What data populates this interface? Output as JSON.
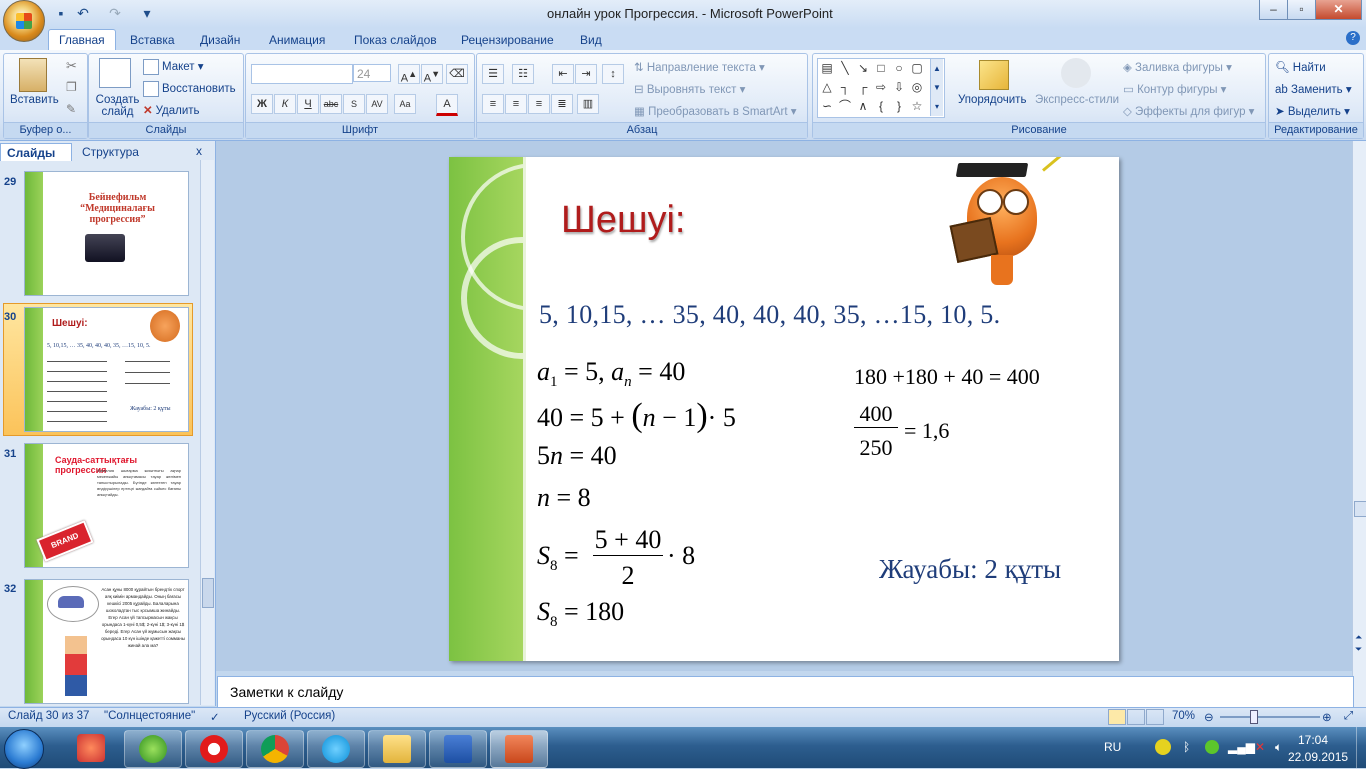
{
  "window": {
    "title": "онлайн урок  Прогрессия. - Microsoft PowerPoint"
  },
  "ribbon_tabs": [
    "Главная",
    "Вставка",
    "Дизайн",
    "Анимация",
    "Показ слайдов",
    "Рецензирование",
    "Вид"
  ],
  "ribbon": {
    "clipboard": {
      "paste": "Вставить",
      "label": "Буфер о..."
    },
    "slides": {
      "create": "Создать слайд",
      "layout": "Макет",
      "reset": "Восстановить",
      "delete": "Удалить",
      "label": "Слайды"
    },
    "font": {
      "font_name": "",
      "font_size": "24",
      "label": "Шрифт"
    },
    "paragraph": {
      "text_direction": "Направление текста",
      "align_text": "Выровнять текст",
      "smartart": "Преобразовать в SmartArt",
      "label": "Абзац"
    },
    "drawing": {
      "arrange": "Упорядочить",
      "quick_styles": "Экспресс-стили",
      "shape_fill": "Заливка фигуры",
      "shape_outline": "Контур фигуры",
      "shape_effects": "Эффекты для фигур",
      "label": "Рисование"
    },
    "editing": {
      "find": "Найти",
      "replace": "Заменить",
      "select": "Выделить",
      "label": "Редактирование"
    }
  },
  "panel": {
    "tab_slides": "Слайды",
    "tab_outline": "Структура"
  },
  "thumbnails": [
    {
      "num": "29",
      "title": "Бейнефильм\n“Медициналағы прогрессия”"
    },
    {
      "num": "30",
      "title": "Шешуі:",
      "seq": "5, 10,15, … 35, 40, 40, 40, 35,  …15, 10, 5.",
      "answer": "Жауабы: 2 құты"
    },
    {
      "num": "31",
      "title": "Сауда-саттықтағы прогрессия",
      "badge": "BRAND",
      "body": "Фамилия шығарма жиынтығы ақпар мекенжайы анықтамасы тауар желімен таныстырылады. Бүгінде көптеген тауар өндірушілер ертеңгі жағдайға сәйкес бағаны анықтайды."
    },
    {
      "num": "32",
      "body": "Асан құны 8000 құрайтын брендтік спорт аяқ киімін армандайды. Оның бағасы кешкісі 2005 құрайды. Балаларына шоколадтан тыс қосымша жинайды. Егер Асан үй тапсырмасын жақсы орындаса 1-күні 0,5$; 2-күні 1$; 3-күні 1$ береді. Егер Асан үй жұмысын жақсы орындаса 10 күн ішінде қажетті сомманы жинай ала ма?"
    }
  ],
  "slide": {
    "heading": "Шешуі:",
    "sequence": "5, 10,15, …  35, 40, 40, 40, 35,   …15, 10, 5.",
    "calc_left": [
      "a1 = 5, an = 40",
      "40 = 5 + (n − 1)·5",
      "5n = 40",
      "n = 8",
      "S8 = (5 + 40)/2 · 8",
      "S8 = 180"
    ],
    "calc_right": [
      "180 +180 + 40 = 400",
      "400/250 = 1,6"
    ],
    "answer": "Жауабы: 2 құты"
  },
  "notes_placeholder": "Заметки к слайду",
  "status": {
    "slide": "Слайд 30 из 37",
    "theme": "\"Солнцестояние\"",
    "language": "Русский (Россия)",
    "zoom": "70%",
    "zoom_level": 0.7
  },
  "taskbar": {
    "lang": "RU",
    "time": "17:04",
    "date": "22.09.2015",
    "apps": [
      "volume-icon",
      "utorrent-icon",
      "opera-icon",
      "chrome-icon",
      "skype-icon",
      "explorer-icon",
      "word-icon",
      "powerpoint-icon"
    ]
  },
  "colors": {
    "ribbon_text": "#15428b",
    "heading": "#b01c1c",
    "answer": "#1f3d7a",
    "slide_green": "#7cc242"
  }
}
